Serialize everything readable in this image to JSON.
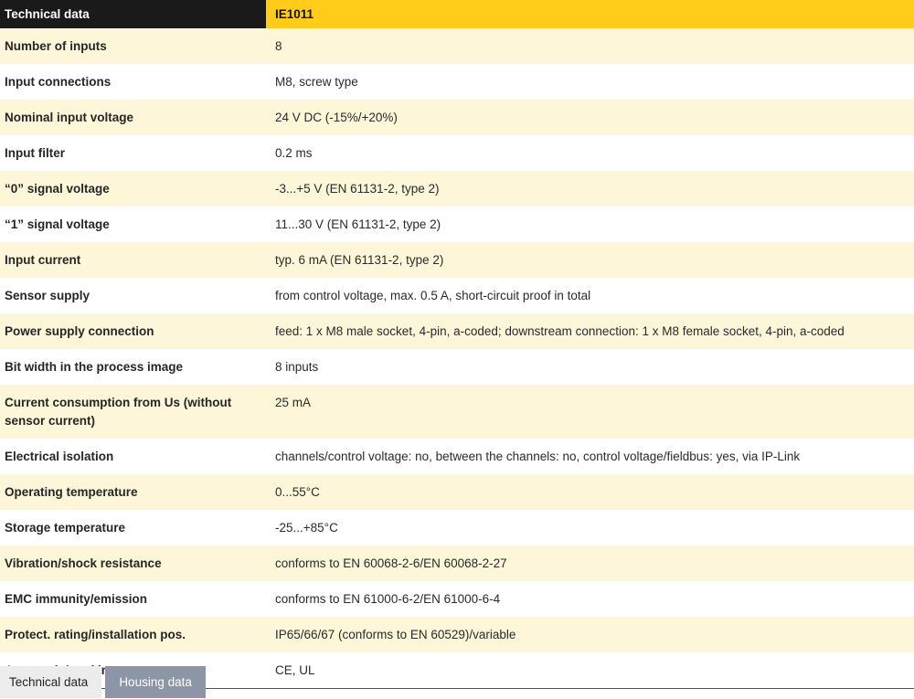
{
  "table": {
    "header": {
      "label": "Technical data",
      "value": "IE1011"
    },
    "rows": [
      {
        "label": "Number of inputs",
        "value": "8"
      },
      {
        "label": "Input connections",
        "value": "M8, screw type"
      },
      {
        "label": "Nominal input voltage",
        "value": "24 V DC (-15%/+20%)"
      },
      {
        "label": "Input filter",
        "value": "0.2 ms"
      },
      {
        "label": "“0” signal voltage",
        "value": "-3...+5 V (EN 61131-2, type 2)"
      },
      {
        "label": "“1” signal voltage",
        "value": "11...30 V (EN 61131-2, type 2)"
      },
      {
        "label": "Input current",
        "value": "typ. 6 mA (EN 61131-2, type 2)"
      },
      {
        "label": "Sensor supply",
        "value": "from control voltage, max. 0.5 A, short-circuit proof in total"
      },
      {
        "label": "Power supply connection",
        "value": "feed: 1 x M8 male socket, 4-pin, a-coded; downstream connection: 1 x M8 female socket, 4-pin, a-coded"
      },
      {
        "label": "Bit width in the process image",
        "value": "8 inputs"
      },
      {
        "label": "Current consumption from Us (without sensor current)",
        "value": "25 mA"
      },
      {
        "label": "Electrical isolation",
        "value": "channels/control voltage: no, between the channels: no, control voltage/fieldbus: yes, via IP-Link"
      },
      {
        "label": "Operating temperature",
        "value": "0...55°C"
      },
      {
        "label": "Storage temperature",
        "value": "-25...+85°C"
      },
      {
        "label": "Vibration/shock resistance",
        "value": "conforms to EN 60068-2-6/EN 60068-2-27"
      },
      {
        "label": "EMC immunity/emission",
        "value": "conforms to EN 61000-6-2/EN 61000-6-4"
      },
      {
        "label": "Protect. rating/installation pos.",
        "value": "IP65/66/67 (conforms to EN 60529)/variable"
      },
      {
        "label": "Approvals/markings",
        "value": "CE, UL"
      }
    ]
  },
  "tabs": [
    {
      "label": "Technical data",
      "active": false
    },
    {
      "label": "Housing data",
      "active": true
    }
  ],
  "colors": {
    "header_label_bg": "#1a1a1a",
    "header_value_bg": "#ffcc1a",
    "row_alt_bg": "#fdf6d8",
    "active_tab_bg": "#8d96a6",
    "inactive_tab_bg": "#ececec"
  }
}
